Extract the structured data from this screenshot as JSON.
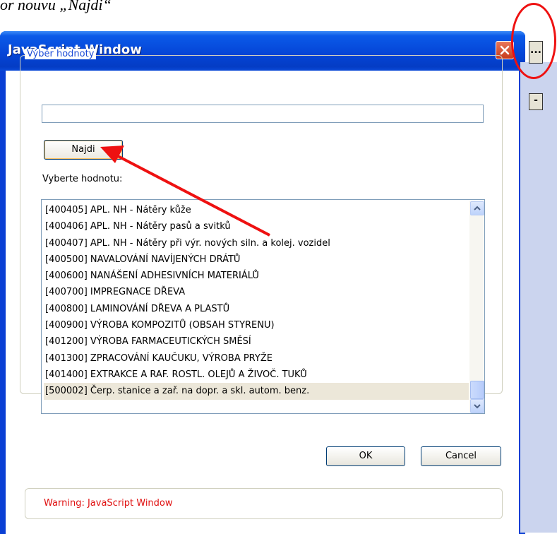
{
  "top_text": "or nouvu „Najdi“",
  "window": {
    "title": "JavaScript Window",
    "group_legend": "Výběr hodnoty",
    "search_value": "",
    "find_label": "Najdi",
    "select_label": "Vyberte hodnotu:",
    "list_items": [
      "[400405] APL. NH - Nátěry kůže",
      "[400406] APL. NH - Nátěry pasů a svitků",
      "[400407] APL. NH - Nátěry při výr. nových siln. a kolej. vozidel",
      "[400500] NAVALOVÁNÍ NAVÍJENÝCH DRÁTŮ",
      "[400600] NANÁŠENÍ ADHESIVNÍCH MATERIÁLŮ",
      "[400700] IMPREGNACE DŘEVA",
      "[400800] LAMINOVÁNÍ DŘEVA A PLASTŮ",
      "[400900] VÝROBA KOMPOZITŮ (OBSAH STYRENU)",
      "[401200] VÝROBA FARMACEUTICKÝCH SMĚSÍ",
      "[401300] ZPRACOVÁNÍ KAUČUKU, VÝROBA PRYŽE",
      "[401400] EXTRAKCE A RAF. ROSTL. OLEJŮ A ŽIVOČ. TUKŮ",
      "[500002] Čerp. stanice a zař. na dopr. a skl. autom. benz."
    ],
    "selected_index": 11,
    "ok_label": "OK",
    "cancel_label": "Cancel",
    "warning": "Warning: JavaScript Window"
  },
  "side": {
    "ellipsis_label": "...",
    "minus_label": "-"
  },
  "icons": {
    "close": "close-icon",
    "scroll_up": "chevron-up-icon",
    "scroll_down": "chevron-down-icon",
    "annotation_arrow": "arrow-icon"
  },
  "colors": {
    "titlebar": "#0546d8",
    "annotation": "#ee1111",
    "warning": "#e01010",
    "legend": "#1c4bd6"
  }
}
